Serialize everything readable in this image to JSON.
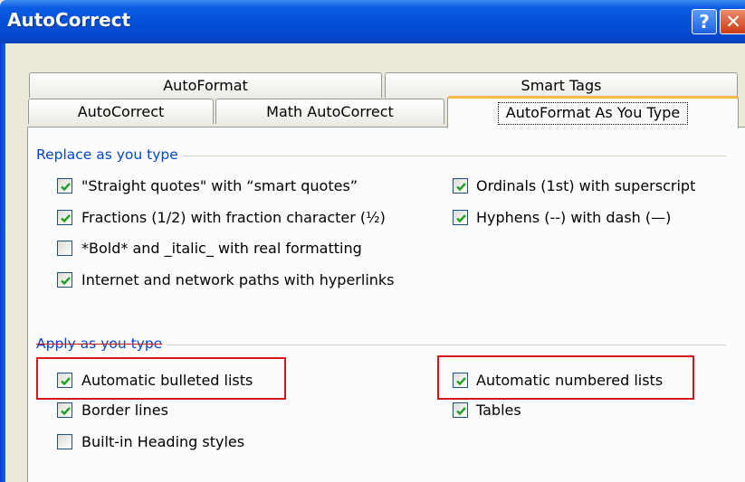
{
  "window": {
    "title": "AutoCorrect",
    "help_label": "?",
    "close_label": "✕"
  },
  "tabs": {
    "row1": [
      "AutoFormat",
      "Smart Tags"
    ],
    "row2": [
      "AutoCorrect",
      "Math AutoCorrect",
      "AutoFormat As You Type"
    ],
    "active": "AutoFormat As You Type"
  },
  "replace_section": {
    "label": "Replace as you type",
    "options": [
      {
        "label": "\"Straight quotes\" with “smart quotes”",
        "checked": true
      },
      {
        "label": "Ordinals (1st) with superscript",
        "checked": true
      },
      {
        "label": "Fractions (1/2) with fraction character (½)",
        "checked": true
      },
      {
        "label": "Hyphens (--) with dash (—)",
        "checked": true
      },
      {
        "label": "*Bold* and _italic_ with real formatting",
        "checked": false
      },
      {
        "label": "Internet and network paths with hyperlinks",
        "checked": true
      }
    ]
  },
  "apply_section": {
    "label": "Apply as you type",
    "options": [
      {
        "label": "Automatic bulleted lists",
        "checked": true
      },
      {
        "label": "Automatic numbered lists",
        "checked": true
      },
      {
        "label": "Border lines",
        "checked": true
      },
      {
        "label": "Tables",
        "checked": true
      },
      {
        "label": "Built-in Heading styles",
        "checked": false
      }
    ]
  },
  "colors": {
    "title_bar": "#0351d8",
    "group_label": "#0046d5",
    "highlight_box": "#d21919",
    "active_tab_accent": "#f6b84a"
  }
}
